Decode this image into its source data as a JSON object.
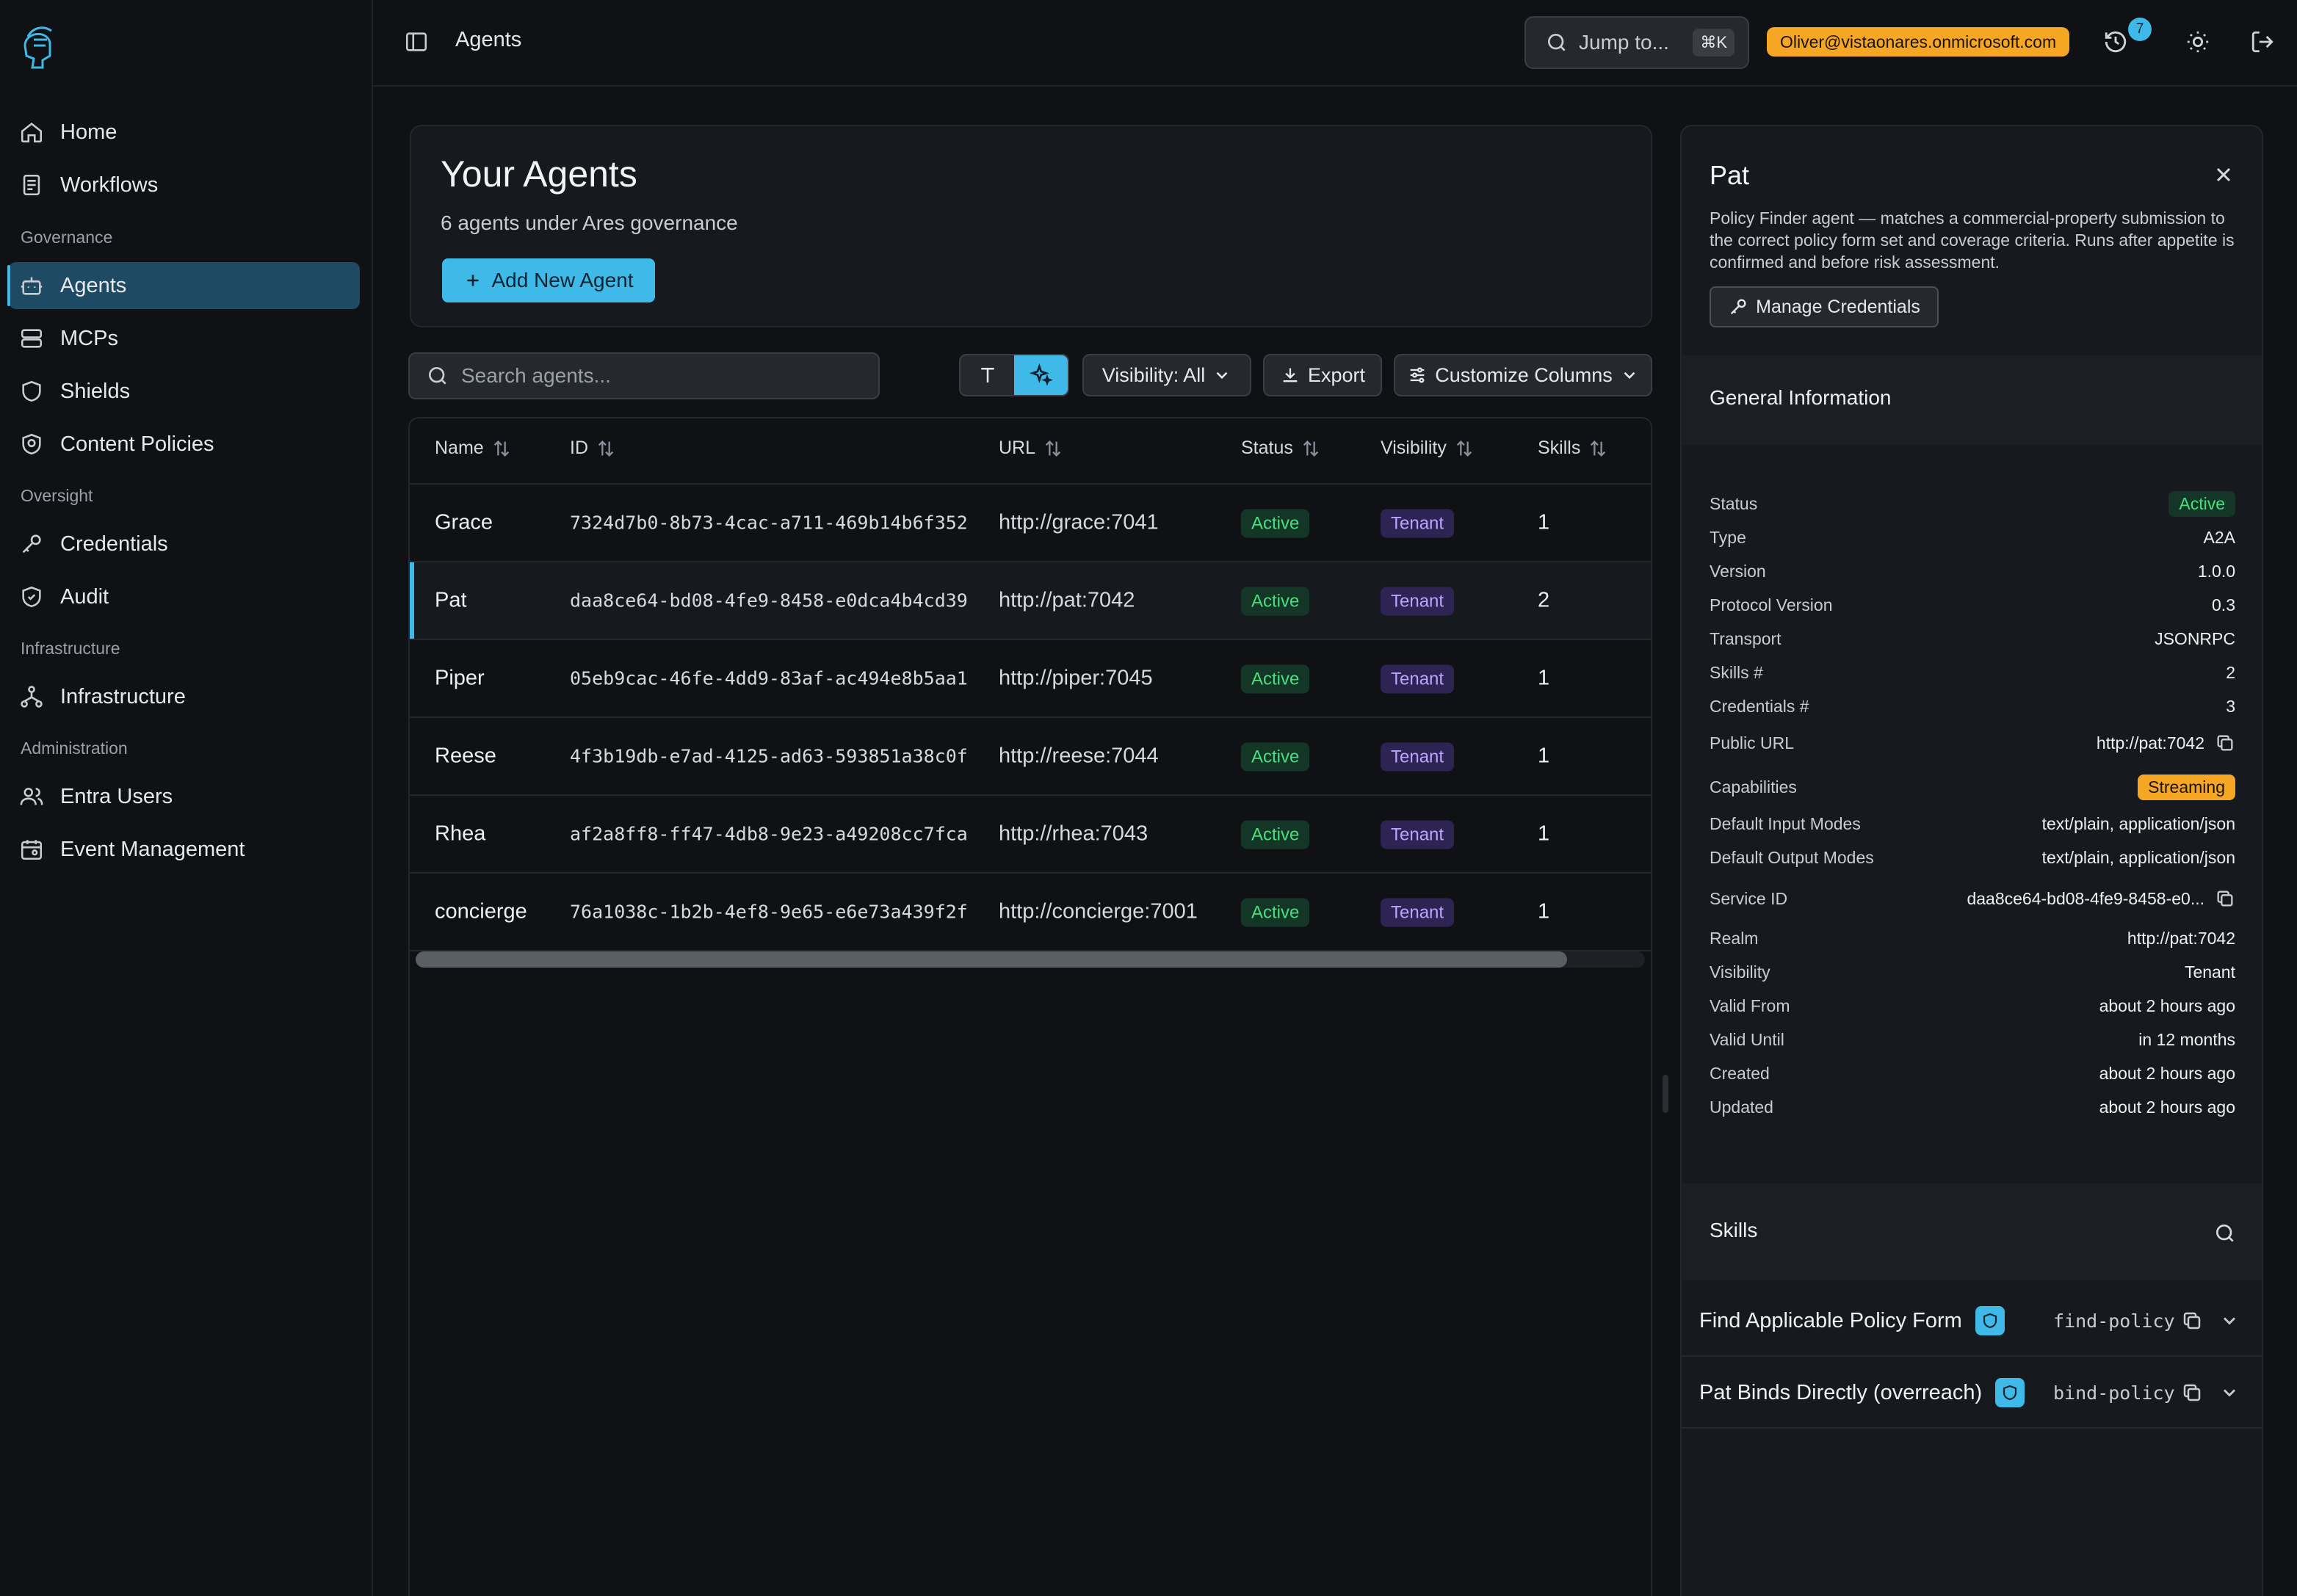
{
  "sidebar": {
    "items": [
      {
        "label": "Home",
        "icon": "home-icon"
      },
      {
        "label": "Workflows",
        "icon": "workflows-icon"
      },
      {
        "section": "Governance"
      },
      {
        "label": "Agents",
        "icon": "bot-icon",
        "active": true
      },
      {
        "label": "MCPs",
        "icon": "server-icon"
      },
      {
        "label": "Shields",
        "icon": "shield-icon"
      },
      {
        "label": "Content Policies",
        "icon": "policy-icon"
      },
      {
        "section": "Oversight"
      },
      {
        "label": "Credentials",
        "icon": "key-icon"
      },
      {
        "label": "Audit",
        "icon": "shield-check-icon"
      },
      {
        "section": "Infrastructure"
      },
      {
        "label": "Infrastructure",
        "icon": "network-icon"
      },
      {
        "section": "Administration"
      },
      {
        "label": "Entra Users",
        "icon": "users-icon"
      },
      {
        "label": "Event Management",
        "icon": "calendar-icon"
      }
    ]
  },
  "header": {
    "breadcrumb": "Agents",
    "jump_label": "Jump to...",
    "jump_shortcut": "⌘K",
    "user_email": "Oliver@vistaonares.onmicrosoft.com",
    "notification_count": "7"
  },
  "agents_card": {
    "title": "Your Agents",
    "subtitle": "6 agents under Ares governance",
    "add_button": "Add New Agent"
  },
  "toolbar": {
    "search_placeholder": "Search agents...",
    "visibility_filter": "Visibility: All",
    "export_label": "Export",
    "customize_label": "Customize Columns"
  },
  "table": {
    "columns": [
      "Name",
      "ID",
      "URL",
      "Status",
      "Visibility",
      "Skills"
    ],
    "rows": [
      {
        "name": "Grace",
        "id": "7324d7b0-8b73-4cac-a711-469b14b6f352",
        "url": "http://grace:7041",
        "status": "Active",
        "visibility": "Tenant",
        "skills": "1"
      },
      {
        "name": "Pat",
        "id": "daa8ce64-bd08-4fe9-8458-e0dca4b4cd39",
        "url": "http://pat:7042",
        "status": "Active",
        "visibility": "Tenant",
        "skills": "2",
        "selected": true
      },
      {
        "name": "Piper",
        "id": "05eb9cac-46fe-4dd9-83af-ac494e8b5aa1",
        "url": "http://piper:7045",
        "status": "Active",
        "visibility": "Tenant",
        "skills": "1"
      },
      {
        "name": "Reese",
        "id": "4f3b19db-e7ad-4125-ad63-593851a38c0f",
        "url": "http://reese:7044",
        "status": "Active",
        "visibility": "Tenant",
        "skills": "1"
      },
      {
        "name": "Rhea",
        "id": "af2a8ff8-ff47-4db8-9e23-a49208cc7fca",
        "url": "http://rhea:7043",
        "status": "Active",
        "visibility": "Tenant",
        "skills": "1"
      },
      {
        "name": "concierge",
        "id": "76a1038c-1b2b-4ef8-9e65-e6e73a439f2f",
        "url": "http://concierge:7001",
        "status": "Active",
        "visibility": "Tenant",
        "skills": "1"
      }
    ]
  },
  "detail": {
    "name": "Pat",
    "description": "Policy Finder agent — matches a commercial-property submission to the correct policy form set and coverage criteria. Runs after appetite is confirmed and before risk assessment.",
    "manage_credentials": "Manage Credentials",
    "general_title": "General Information",
    "fields": [
      {
        "k": "Status",
        "v": "Active",
        "kind": "badge-active"
      },
      {
        "k": "Type",
        "v": "A2A"
      },
      {
        "k": "Version",
        "v": "1.0.0"
      },
      {
        "k": "Protocol Version",
        "v": "0.3"
      },
      {
        "k": "Transport",
        "v": "JSONRPC"
      },
      {
        "k": "Skills #",
        "v": "2"
      },
      {
        "k": "Credentials #",
        "v": "3"
      },
      {
        "k": "Public URL",
        "v": "http://pat:7042",
        "kind": "copy"
      },
      {
        "k": "Capabilities",
        "v": "Streaming",
        "kind": "badge-stream"
      },
      {
        "k": "Default Input Modes",
        "v": "text/plain, application/json"
      },
      {
        "k": "Default Output Modes",
        "v": "text/plain, application/json"
      },
      {
        "k": "Service ID",
        "v": "daa8ce64-bd08-4fe9-8458-e0...",
        "kind": "copy"
      },
      {
        "k": "Realm",
        "v": "http://pat:7042"
      },
      {
        "k": "Visibility",
        "v": "Tenant"
      },
      {
        "k": "Valid From",
        "v": "about 2 hours ago"
      },
      {
        "k": "Valid Until",
        "v": "in 12 months"
      },
      {
        "k": "Created",
        "v": "about 2 hours ago"
      },
      {
        "k": "Updated",
        "v": "about 2 hours ago"
      }
    ],
    "skills_title": "Skills",
    "skills": [
      {
        "name": "Find Applicable Policy Form",
        "id": "find-policy"
      },
      {
        "name": "Pat Binds Directly (overreach)",
        "id": "bind-policy"
      }
    ]
  },
  "colors": {
    "accent": "#3fb9e8",
    "background": "#0f1114",
    "active_green": "#4ade80",
    "tenant_purple": "#b7a6ff",
    "warning_orange": "#f5a623"
  }
}
